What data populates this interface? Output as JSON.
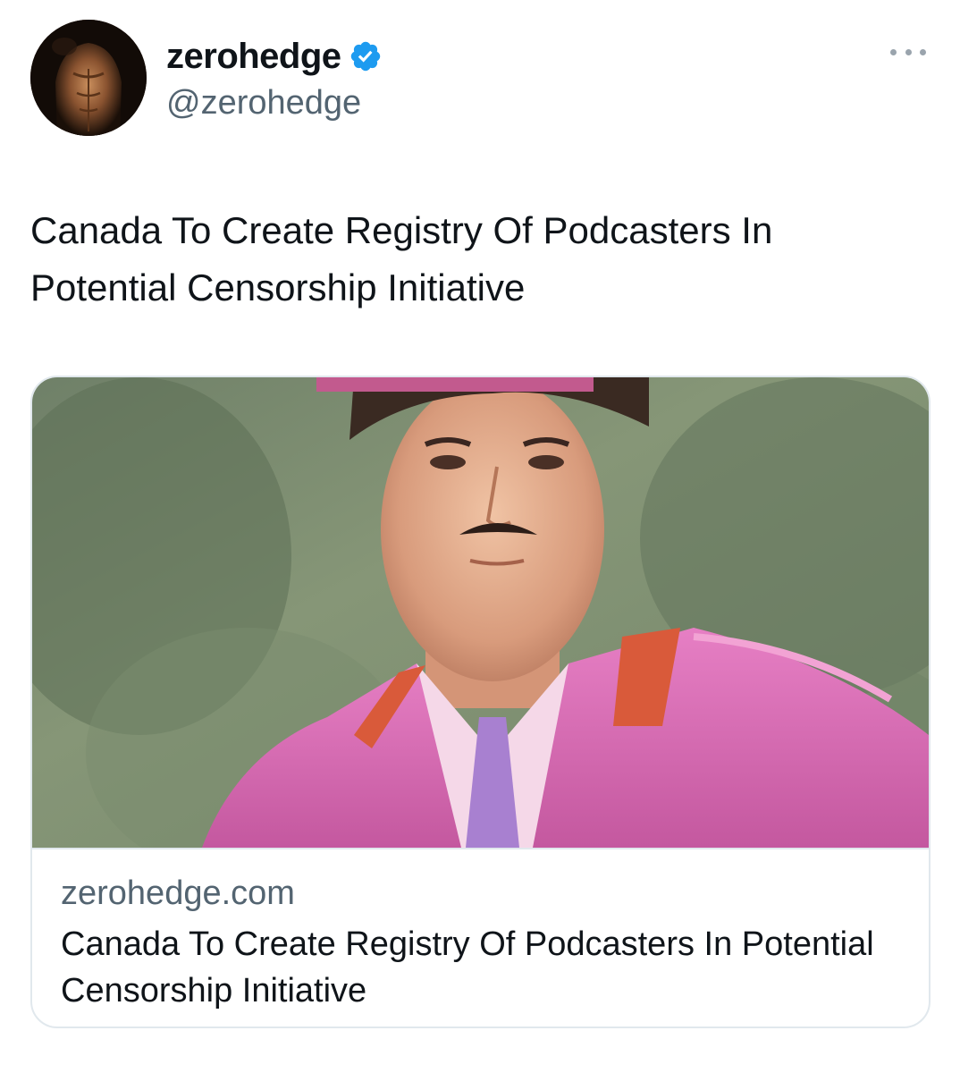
{
  "author": {
    "display_name": "zerohedge",
    "handle": "@zerohedge",
    "verified_icon": "verified-badge-icon",
    "verified_color": "#1d9bf0",
    "avatar_icon": "avatar-photo"
  },
  "more_icon": "more-options-icon",
  "tweet": {
    "text": "Canada To Create Registry Of Podcasters In Potential Censorship Initiative"
  },
  "card": {
    "image_icon": "link-preview-image",
    "domain": "zerohedge.com",
    "title": "Canada To Create Registry Of Podcasters In Potential Censorship Initiative"
  }
}
